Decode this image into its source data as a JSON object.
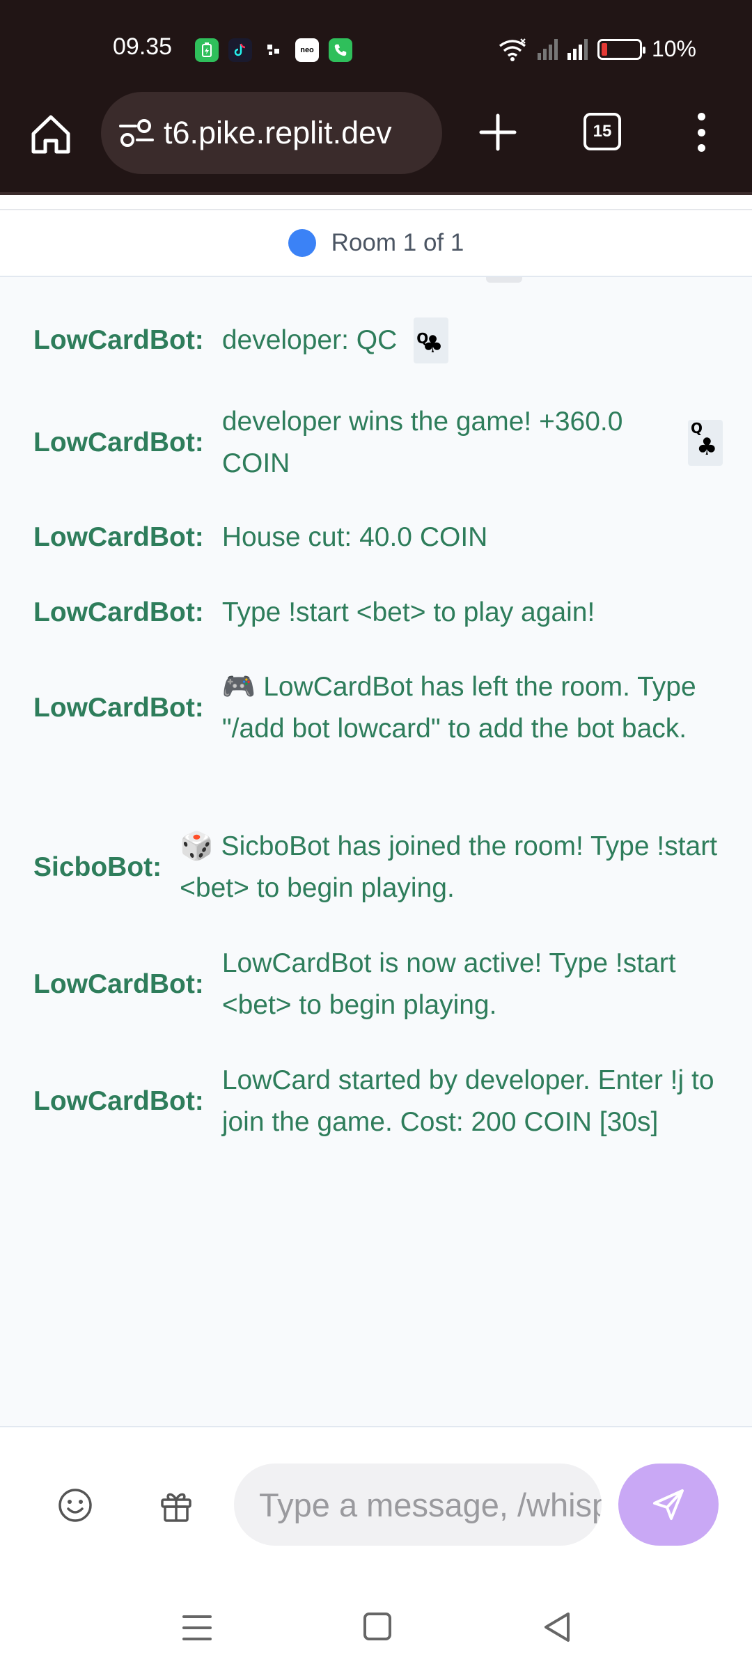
{
  "status_bar": {
    "time": "09.35",
    "battery_percent": "10%",
    "app_icons": [
      "battery-saver-icon",
      "tiktok-icon",
      "app-icon",
      "neo-icon",
      "phone-icon"
    ],
    "neo_label": "neo"
  },
  "browser": {
    "url": "t6.pike.replit.dev",
    "tab_count": "15"
  },
  "room": {
    "label": "Room 1 of 1",
    "indicator_color": "#3b82f6"
  },
  "messages": [
    {
      "sender": "LowCardBot:",
      "text": "developer: QC",
      "card": {
        "rank": "Q",
        "suit": "♣"
      }
    },
    {
      "sender": "LowCardBot:",
      "text": "developer wins the game! +360.0 COIN",
      "card": {
        "rank": "Q",
        "suit": "♣"
      }
    },
    {
      "sender": "LowCardBot:",
      "text": "House cut: 40.0 COIN"
    },
    {
      "sender": "LowCardBot:",
      "text": "Type !start <bet> to play again!"
    },
    {
      "sender": "LowCardBot:",
      "text": "🎮 LowCardBot has left the room. Type \"/add bot lowcard\" to add the bot back."
    },
    {
      "sender": "SicboBot:",
      "text": "🎲 SicboBot has joined the room! Type !start <bet> to begin playing."
    },
    {
      "sender": "LowCardBot:",
      "text": "LowCardBot is now active! Type !start <bet> to begin playing."
    },
    {
      "sender": "LowCardBot:",
      "text": "LowCard started by developer. Enter !j to join the game. Cost: 200 COIN [30s]"
    }
  ],
  "composer": {
    "placeholder": "Type a message, /whisper",
    "send_color": "#c9a8f5"
  },
  "colors": {
    "bot_text": "#2e7d5b",
    "browser_bg": "#211515"
  }
}
